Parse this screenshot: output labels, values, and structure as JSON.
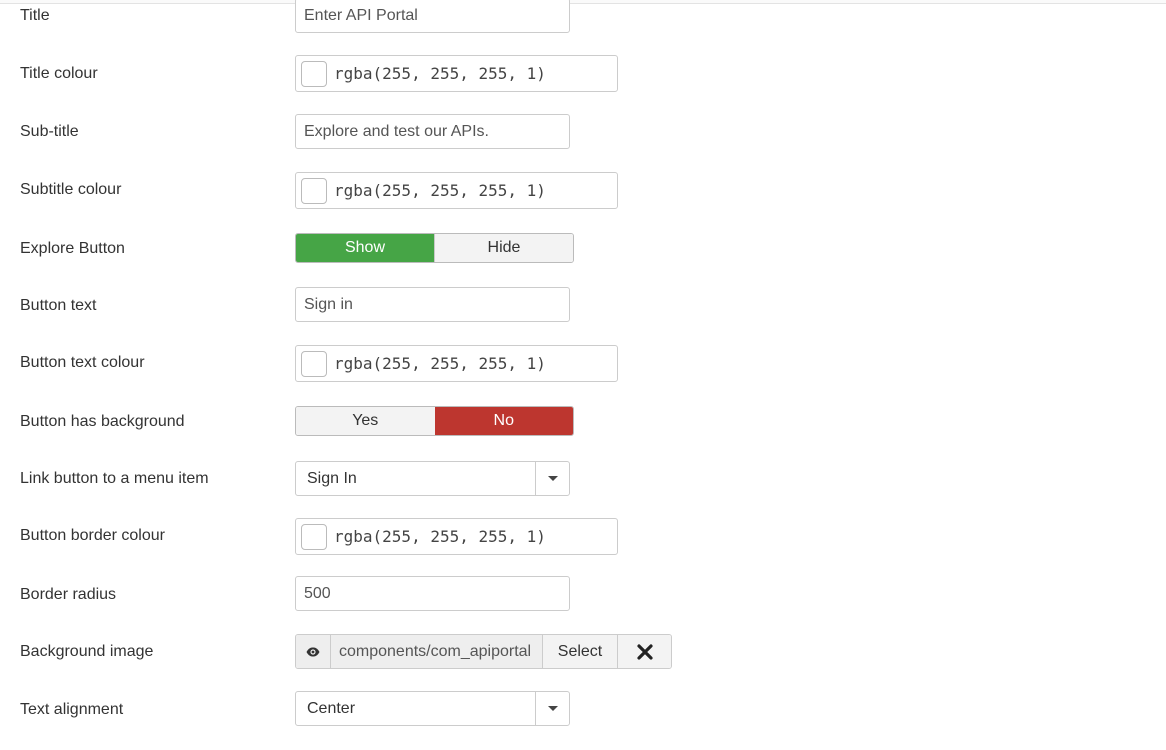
{
  "fields": {
    "title": {
      "label": "Title",
      "value": "Enter API Portal"
    },
    "title_colour": {
      "label": "Title colour",
      "value": "rgba(255, 255, 255, 1)",
      "swatch": "#ffffff"
    },
    "subtitle": {
      "label": "Sub-title",
      "value": "Explore and test our APIs."
    },
    "subtitle_colour": {
      "label": "Subtitle colour",
      "value": "rgba(255, 255, 255, 1)",
      "swatch": "#ffffff"
    },
    "explore_button": {
      "label": "Explore Button",
      "options": [
        "Show",
        "Hide"
      ],
      "selected": "Show",
      "active_color": "#46a546"
    },
    "button_text": {
      "label": "Button text",
      "value": "Sign in"
    },
    "button_text_colour": {
      "label": "Button text colour",
      "value": "rgba(255, 255, 255, 1)",
      "swatch": "#ffffff"
    },
    "button_has_background": {
      "label": "Button has background",
      "options": [
        "Yes",
        "No"
      ],
      "selected": "No",
      "active_color": "#bd362f"
    },
    "link_menu_item": {
      "label": "Link button to a menu item",
      "selected": "Sign In"
    },
    "button_border_colour": {
      "label": "Button border colour",
      "value": "rgba(255, 255, 255, 1)",
      "swatch": "#ffffff"
    },
    "border_radius": {
      "label": "Border radius",
      "value": "500"
    },
    "background_image": {
      "label": "Background image",
      "path": "components/com_apiportal",
      "select_label": "Select",
      "preview_icon": "eye-icon",
      "clear_icon": "close-icon"
    },
    "text_alignment": {
      "label": "Text alignment",
      "selected": "Center"
    }
  }
}
